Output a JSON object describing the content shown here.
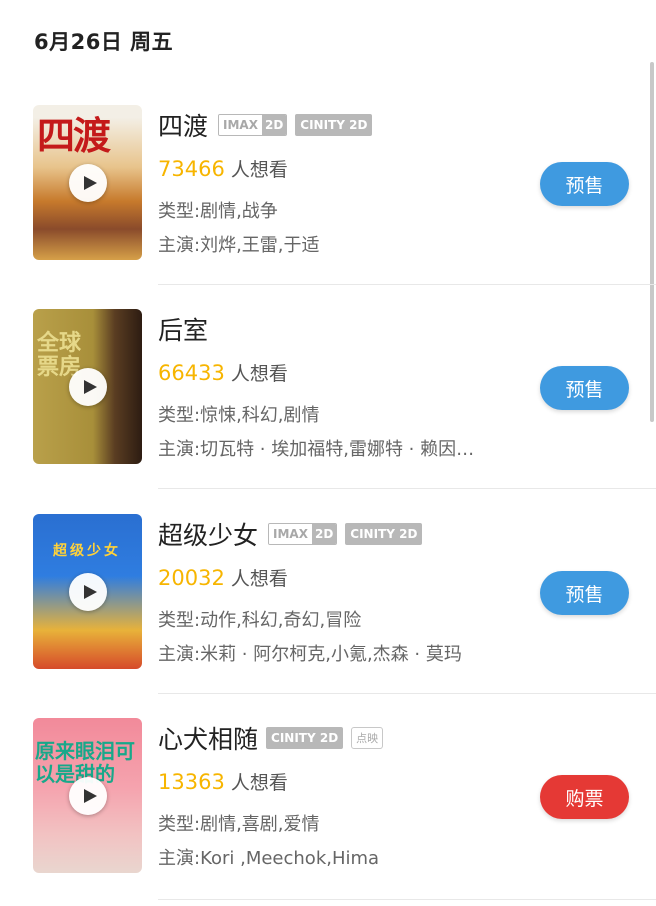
{
  "header": {
    "date": "6月26日 周五"
  },
  "want_suffix": "人想看",
  "tags": {
    "imax_a": "IMAX",
    "imax_b": "2D",
    "cinity": "CINITY 2D",
    "point": "点映"
  },
  "movies": [
    {
      "title": "四渡",
      "want_count": "73466",
      "genre": "类型:剧情,战争",
      "cast": "主演:刘烨,王雷,于适",
      "action": "预售",
      "poster_text": "四渡"
    },
    {
      "title": "后室",
      "want_count": "66433",
      "genre": "类型:惊悚,科幻,剧情",
      "cast": "主演:切瓦特 · 埃加福特,雷娜特 · 赖因…",
      "action": "预售",
      "poster_text": "全球票房"
    },
    {
      "title": "超级少女",
      "want_count": "20032",
      "genre": "类型:动作,科幻,奇幻,冒险",
      "cast": "主演:米莉 · 阿尔柯克,小氪,杰森 · 莫玛",
      "action": "预售",
      "poster_text": "超级少女"
    },
    {
      "title": "心犬相随",
      "want_count": "13363",
      "genre": "类型:剧情,喜剧,爱情",
      "cast": "主演:Kori ,Meechok,Hima",
      "action": "购票",
      "poster_text": "原来眼泪可以是甜的"
    }
  ],
  "colors": {
    "want_number": "#f7b500",
    "presale_button": "#3f9ae0",
    "buy_button": "#e53935"
  },
  "icons": {
    "play": "play-icon"
  }
}
